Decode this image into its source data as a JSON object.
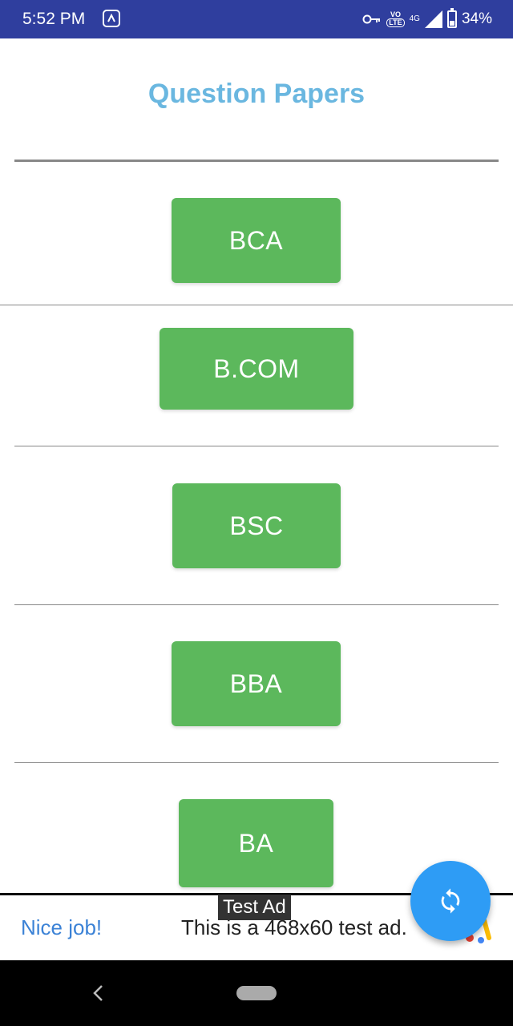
{
  "status_bar": {
    "time": "5:52 PM",
    "network": "4G",
    "volte_top": "VO",
    "volte_bottom": "LTE",
    "battery": "34%",
    "battery_level": 0.34
  },
  "title": "Question Papers",
  "courses": [
    {
      "label": "BCA"
    },
    {
      "label": "B.COM"
    },
    {
      "label": "BSC"
    },
    {
      "label": "BBA"
    },
    {
      "label": "BA"
    }
  ],
  "ad": {
    "label": "Test Ad",
    "headline": "Nice job!",
    "text": "This is a 468x60 test ad."
  },
  "colors": {
    "status_bar": "#2f3e9e",
    "title": "#6ab7e0",
    "button": "#5cb85c",
    "fab": "#2e9cf5"
  },
  "icons": {
    "fab": "refresh-icon",
    "status": [
      "app-icon",
      "key-icon",
      "signal-icon",
      "battery-icon"
    ]
  }
}
